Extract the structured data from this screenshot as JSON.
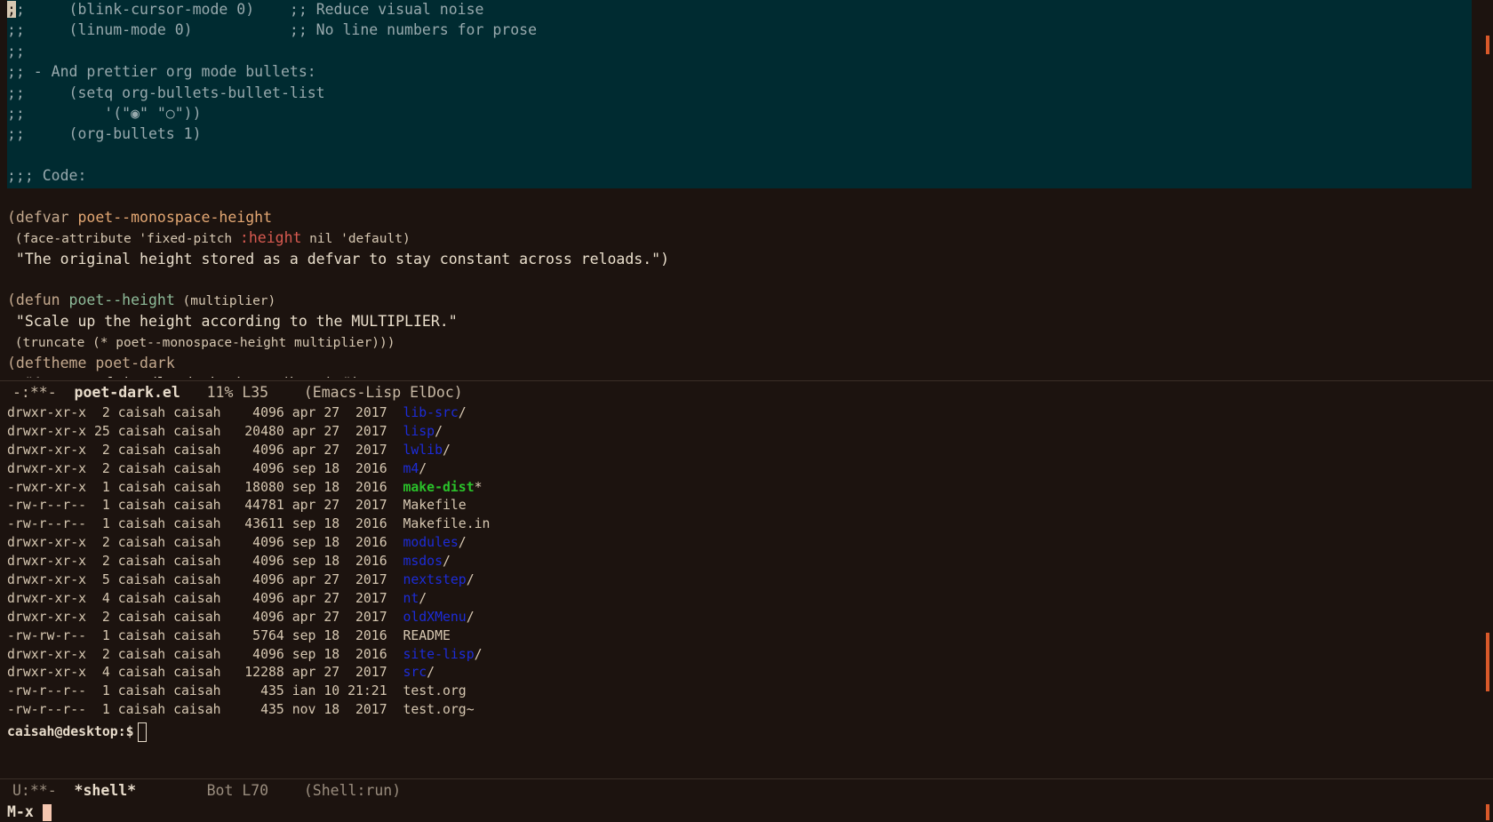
{
  "code": {
    "lines": [
      {
        "parts": [
          {
            "t": ";",
            "cls": "cursor-block"
          },
          {
            "t": ";     (blink-cursor-mode 0)    ;; Reduce visual noise",
            "cls": "cmt"
          }
        ]
      },
      {
        "parts": [
          {
            "t": ";;     (linum-mode 0)           ;; No line numbers for prose",
            "cls": "cmt"
          }
        ]
      },
      {
        "parts": [
          {
            "t": ";;",
            "cls": "cmt"
          }
        ]
      },
      {
        "parts": [
          {
            "t": ";; - And prettier org mode bullets:",
            "cls": "cmt"
          }
        ]
      },
      {
        "parts": [
          {
            "t": ";;     (setq org-bullets-bullet-list",
            "cls": "cmt"
          }
        ]
      },
      {
        "parts": [
          {
            "t": ";;         '(\"◉\" \"○\"))",
            "cls": "cmt"
          }
        ]
      },
      {
        "parts": [
          {
            "t": ";;     (org-bullets 1)",
            "cls": "cmt"
          }
        ]
      },
      {
        "parts": [
          {
            "t": "",
            "cls": "cmt"
          }
        ]
      },
      {
        "parts": [
          {
            "t": ";;; Code:",
            "cls": "cmt"
          }
        ]
      },
      {
        "parts": [
          {
            "t": "",
            "cls": ""
          }
        ]
      },
      {
        "parts": [
          {
            "t": "(defvar ",
            "cls": "kw"
          },
          {
            "t": "poet--monospace-height",
            "cls": "vname"
          }
        ]
      },
      {
        "parts": [
          {
            "t": " (face-attribute 'fixed-pitch ",
            "cls": "small"
          },
          {
            "t": ":height",
            "cls": "kwd"
          },
          {
            "t": " nil 'default)",
            "cls": "small"
          }
        ]
      },
      {
        "parts": [
          {
            "t": " \"The original height stored as a defvar to stay constant across reloads.\")",
            "cls": "str"
          }
        ]
      },
      {
        "parts": [
          {
            "t": "",
            "cls": ""
          }
        ]
      },
      {
        "parts": [
          {
            "t": "(defun ",
            "cls": "kw"
          },
          {
            "t": "poet--height",
            "cls": "fname"
          },
          {
            "t": " (multiplier)",
            "cls": "small"
          }
        ]
      },
      {
        "parts": [
          {
            "t": " \"Scale up the height according to the MULTIPLIER.\"",
            "cls": "str"
          }
        ]
      },
      {
        "parts": [
          {
            "t": " (truncate (* poet--monospace-height multiplier)))",
            "cls": "small"
          }
        ]
      },
      {
        "parts": [
          {
            "t": "(deftheme ",
            "cls": "kw"
          },
          {
            "t": "poet-dark",
            "cls": "kw"
          }
        ]
      },
      {
        "parts": [
          {
            "t": "  \"A prose friendly dark theme (beta).\")",
            "cls": "str"
          }
        ]
      }
    ]
  },
  "modeline_top": {
    "state": "-:**-",
    "buffer": "poet-dark.el",
    "position": "11% L35",
    "modes": "(Emacs-Lisp ElDoc)"
  },
  "shell": {
    "rows": [
      {
        "perm": "drwxr-xr-x",
        "links": "2",
        "user": "caisah",
        "group": "caisah",
        "size": "4096",
        "mon": "apr",
        "day": "27",
        "time": "2017",
        "name": "lib-src",
        "type": "dir",
        "suffix": "/"
      },
      {
        "perm": "drwxr-xr-x",
        "links": "25",
        "user": "caisah",
        "group": "caisah",
        "size": "20480",
        "mon": "apr",
        "day": "27",
        "time": "2017",
        "name": "lisp",
        "type": "dir",
        "suffix": "/"
      },
      {
        "perm": "drwxr-xr-x",
        "links": "2",
        "user": "caisah",
        "group": "caisah",
        "size": "4096",
        "mon": "apr",
        "day": "27",
        "time": "2017",
        "name": "lwlib",
        "type": "dir",
        "suffix": "/"
      },
      {
        "perm": "drwxr-xr-x",
        "links": "2",
        "user": "caisah",
        "group": "caisah",
        "size": "4096",
        "mon": "sep",
        "day": "18",
        "time": "2016",
        "name": "m4",
        "type": "dir",
        "suffix": "/"
      },
      {
        "perm": "-rwxr-xr-x",
        "links": "1",
        "user": "caisah",
        "group": "caisah",
        "size": "18080",
        "mon": "sep",
        "day": "18",
        "time": "2016",
        "name": "make-dist",
        "type": "exe",
        "suffix": "*"
      },
      {
        "perm": "-rw-r--r--",
        "links": "1",
        "user": "caisah",
        "group": "caisah",
        "size": "44781",
        "mon": "apr",
        "day": "27",
        "time": "2017",
        "name": "Makefile",
        "type": "file",
        "suffix": ""
      },
      {
        "perm": "-rw-r--r--",
        "links": "1",
        "user": "caisah",
        "group": "caisah",
        "size": "43611",
        "mon": "sep",
        "day": "18",
        "time": "2016",
        "name": "Makefile.in",
        "type": "file",
        "suffix": ""
      },
      {
        "perm": "drwxr-xr-x",
        "links": "2",
        "user": "caisah",
        "group": "caisah",
        "size": "4096",
        "mon": "sep",
        "day": "18",
        "time": "2016",
        "name": "modules",
        "type": "dir",
        "suffix": "/"
      },
      {
        "perm": "drwxr-xr-x",
        "links": "2",
        "user": "caisah",
        "group": "caisah",
        "size": "4096",
        "mon": "sep",
        "day": "18",
        "time": "2016",
        "name": "msdos",
        "type": "dir",
        "suffix": "/"
      },
      {
        "perm": "drwxr-xr-x",
        "links": "5",
        "user": "caisah",
        "group": "caisah",
        "size": "4096",
        "mon": "apr",
        "day": "27",
        "time": "2017",
        "name": "nextstep",
        "type": "dir",
        "suffix": "/"
      },
      {
        "perm": "drwxr-xr-x",
        "links": "4",
        "user": "caisah",
        "group": "caisah",
        "size": "4096",
        "mon": "apr",
        "day": "27",
        "time": "2017",
        "name": "nt",
        "type": "dir",
        "suffix": "/"
      },
      {
        "perm": "drwxr-xr-x",
        "links": "2",
        "user": "caisah",
        "group": "caisah",
        "size": "4096",
        "mon": "apr",
        "day": "27",
        "time": "2017",
        "name": "oldXMenu",
        "type": "dir",
        "suffix": "/"
      },
      {
        "perm": "-rw-rw-r--",
        "links": "1",
        "user": "caisah",
        "group": "caisah",
        "size": "5764",
        "mon": "sep",
        "day": "18",
        "time": "2016",
        "name": "README",
        "type": "file",
        "suffix": ""
      },
      {
        "perm": "drwxr-xr-x",
        "links": "2",
        "user": "caisah",
        "group": "caisah",
        "size": "4096",
        "mon": "sep",
        "day": "18",
        "time": "2016",
        "name": "site-lisp",
        "type": "dir",
        "suffix": "/"
      },
      {
        "perm": "drwxr-xr-x",
        "links": "4",
        "user": "caisah",
        "group": "caisah",
        "size": "12288",
        "mon": "apr",
        "day": "27",
        "time": "2017",
        "name": "src",
        "type": "dir",
        "suffix": "/"
      },
      {
        "perm": "-rw-r--r--",
        "links": "1",
        "user": "caisah",
        "group": "caisah",
        "size": "435",
        "mon": "ian",
        "day": "10",
        "time": "21:21",
        "name": "test.org",
        "type": "file",
        "suffix": ""
      },
      {
        "perm": "-rw-r--r--",
        "links": "1",
        "user": "caisah",
        "group": "caisah",
        "size": "435",
        "mon": "nov",
        "day": "18",
        "time": "2017",
        "name": "test.org~",
        "type": "file",
        "suffix": ""
      }
    ],
    "prompt": "caisah@desktop:$"
  },
  "modeline_bottom": {
    "state": "U:**-",
    "buffer": "*shell*",
    "position": "Bot L70",
    "modes": "(Shell:run)"
  },
  "minibuffer": {
    "text": "M-x"
  },
  "colors": {
    "background": "#1c130f",
    "region": "#002b31",
    "directory": "#1c2cd8",
    "executable": "#2ac22a",
    "scroll_marker": "#d8592a"
  }
}
